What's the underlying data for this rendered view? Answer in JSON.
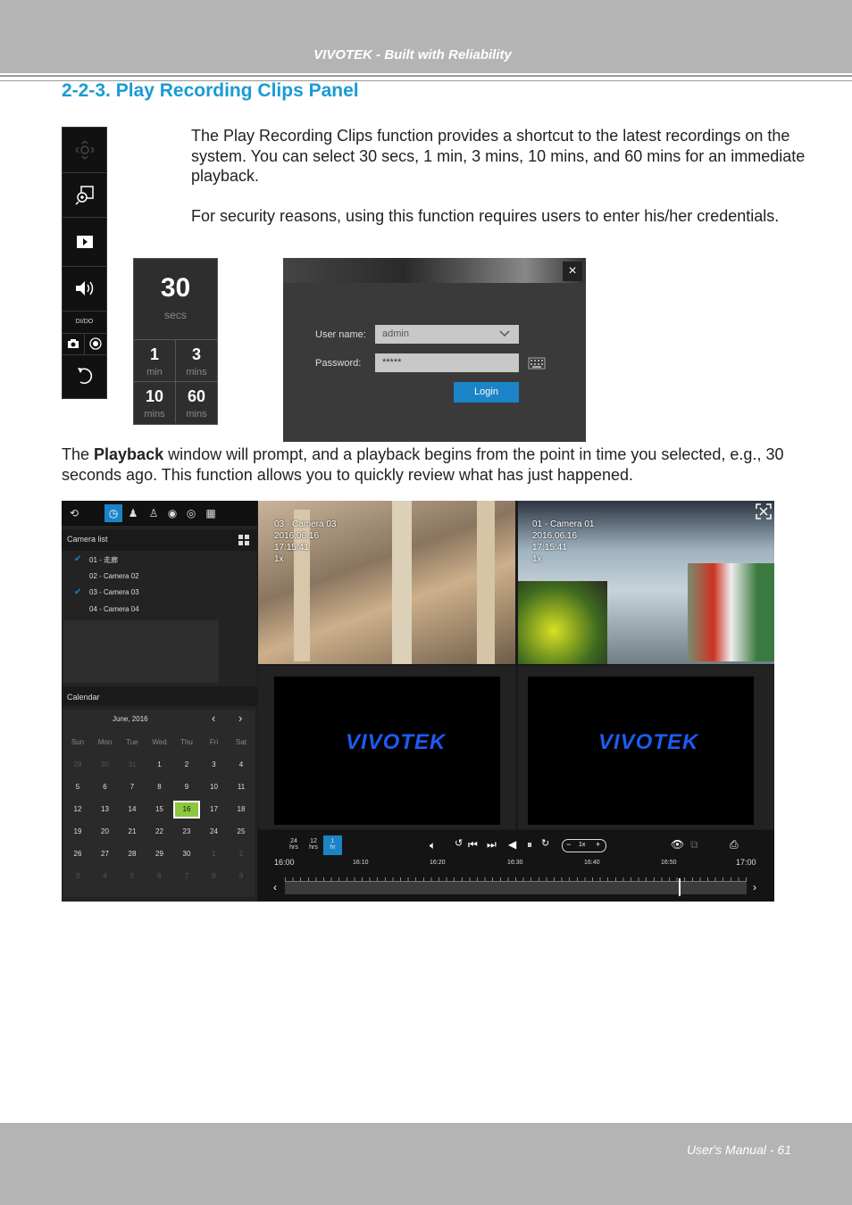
{
  "header": {
    "title": "VIVOTEK - Built with Reliability"
  },
  "section": {
    "title": "2-2-3. Play Recording Clips Panel"
  },
  "paragraphs": {
    "p1": "The Play Recording Clips function provides a shortcut to the latest recordings on the system. You can select 30 secs, 1 min, 3 mins, 10 mins, and 60 mins for an immediate playback.",
    "p2": "For security reasons, using this function requires users to enter his/her credentials.",
    "p3_pre": "The ",
    "p3_bold": "Playback",
    "p3_post": " window will prompt, and a playback begins from the point in time you selected, e.g., 30 seconds ago. This function allows you to quickly review what has just happened."
  },
  "toolbar": {
    "dio_label": "DI/DO"
  },
  "clips": {
    "big": {
      "value": "30",
      "unit": "secs"
    },
    "cells": [
      {
        "value": "1",
        "unit": "min"
      },
      {
        "value": "3",
        "unit": "mins"
      },
      {
        "value": "10",
        "unit": "mins"
      },
      {
        "value": "60",
        "unit": "mins"
      }
    ]
  },
  "login": {
    "close": "×",
    "username_label": "User name:",
    "username_value": "admin",
    "password_label": "Password:",
    "password_value": "*****",
    "button": "Login"
  },
  "playback": {
    "camera_list_label": "Camera list",
    "cameras": [
      "01 - 走廊",
      "02 - Camera 02",
      "03 - Camera 03",
      "04 - Camera 04"
    ],
    "calendar_label": "Calendar",
    "month": "June, 2016",
    "prev": "‹",
    "next": "›",
    "weekdays": [
      "Sun",
      "Mon",
      "Tue",
      "Wed",
      "Thu",
      "Fri",
      "Sat"
    ],
    "days": [
      [
        "29",
        "30",
        "31",
        "1",
        "2",
        "3",
        "4"
      ],
      [
        "5",
        "6",
        "7",
        "8",
        "9",
        "10",
        "11"
      ],
      [
        "12",
        "13",
        "14",
        "15",
        "16",
        "17",
        "18"
      ],
      [
        "19",
        "20",
        "21",
        "22",
        "23",
        "24",
        "25"
      ],
      [
        "26",
        "27",
        "28",
        "29",
        "30",
        "1",
        "2"
      ],
      [
        "3",
        "4",
        "5",
        "6",
        "7",
        "8",
        "9"
      ]
    ],
    "selected_day": "16",
    "cam1_overlay": [
      "03 - Camera 03",
      "2016.06.16",
      "17:15:41",
      "1x"
    ],
    "cam2_overlay": [
      "01 - Camera 01",
      "2016.06.16",
      "17:15:41",
      "1x"
    ],
    "logo": "VIVOTEK",
    "range_24": [
      "24",
      "hrs"
    ],
    "range_12": [
      "12",
      "hrs"
    ],
    "range_1": [
      "1",
      "hr"
    ],
    "speed": "1x",
    "time_start": "16:00",
    "time_end": "17:00",
    "ticks": [
      "16:10",
      "16:20",
      "16:30",
      "16:40",
      "16:50"
    ]
  },
  "footer": {
    "page": "User's Manual - 61"
  },
  "colors": {
    "accent": "#1a9ad6",
    "highlight": "#8dc63f",
    "brand_blue": "#1d5bf0"
  }
}
